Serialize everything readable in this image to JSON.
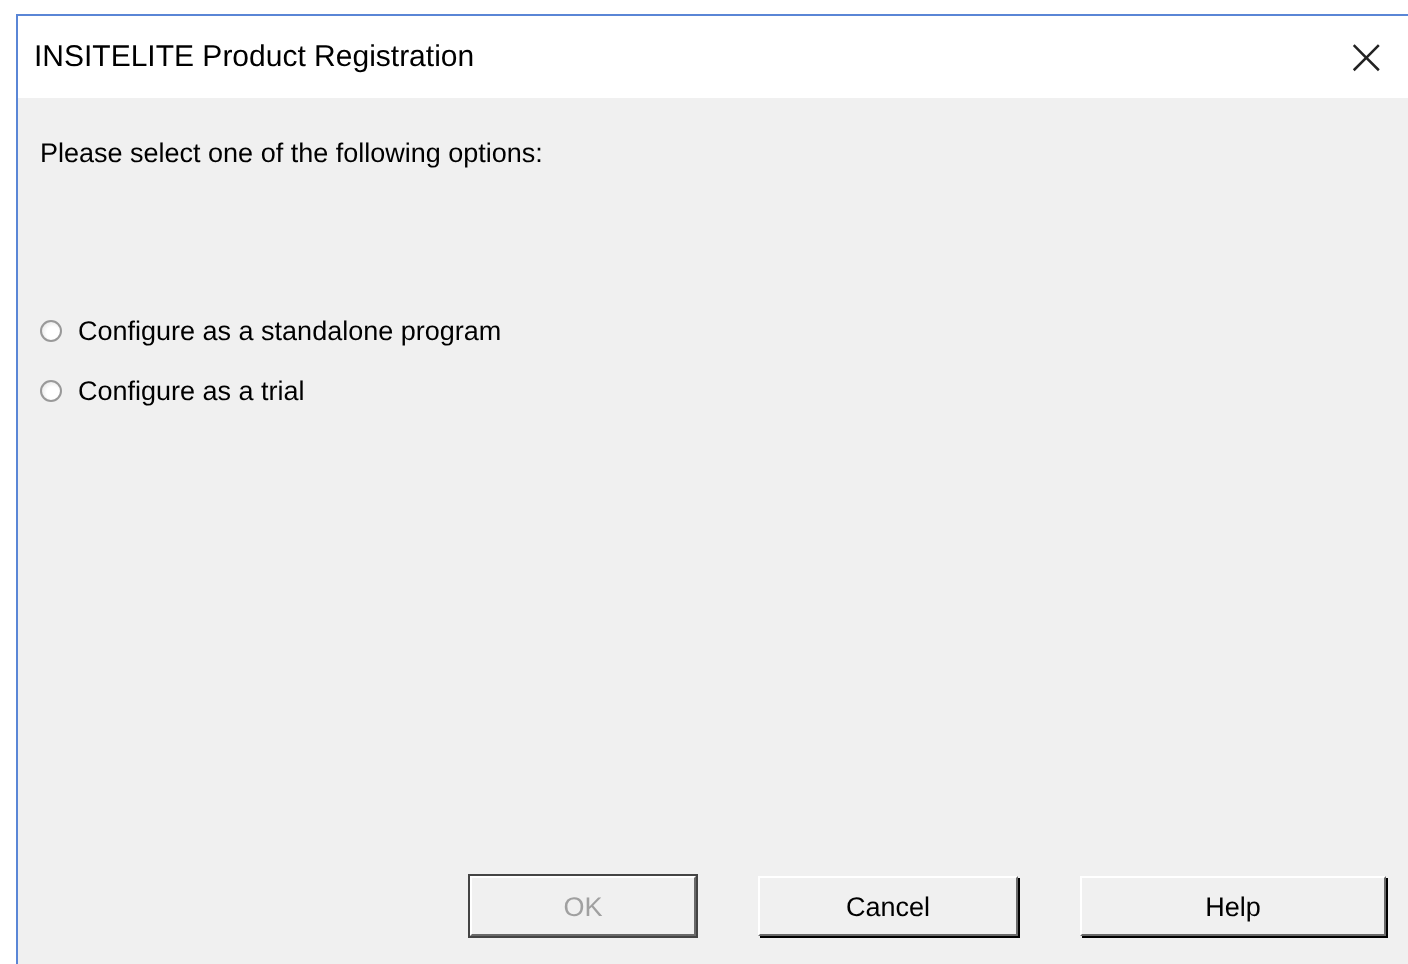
{
  "window": {
    "title": "INSITELITE Product Registration",
    "close": "×"
  },
  "prompt": "Please select one of the following options:",
  "options": [
    {
      "label": "Configure as a standalone program",
      "selected": false
    },
    {
      "label": "Configure as a trial",
      "selected": false
    }
  ],
  "buttons": [
    {
      "label": "OK",
      "disabled": true,
      "default": true
    },
    {
      "label": "Cancel",
      "disabled": false,
      "default": false
    },
    {
      "label": "Help",
      "disabled": false,
      "default": false
    }
  ]
}
